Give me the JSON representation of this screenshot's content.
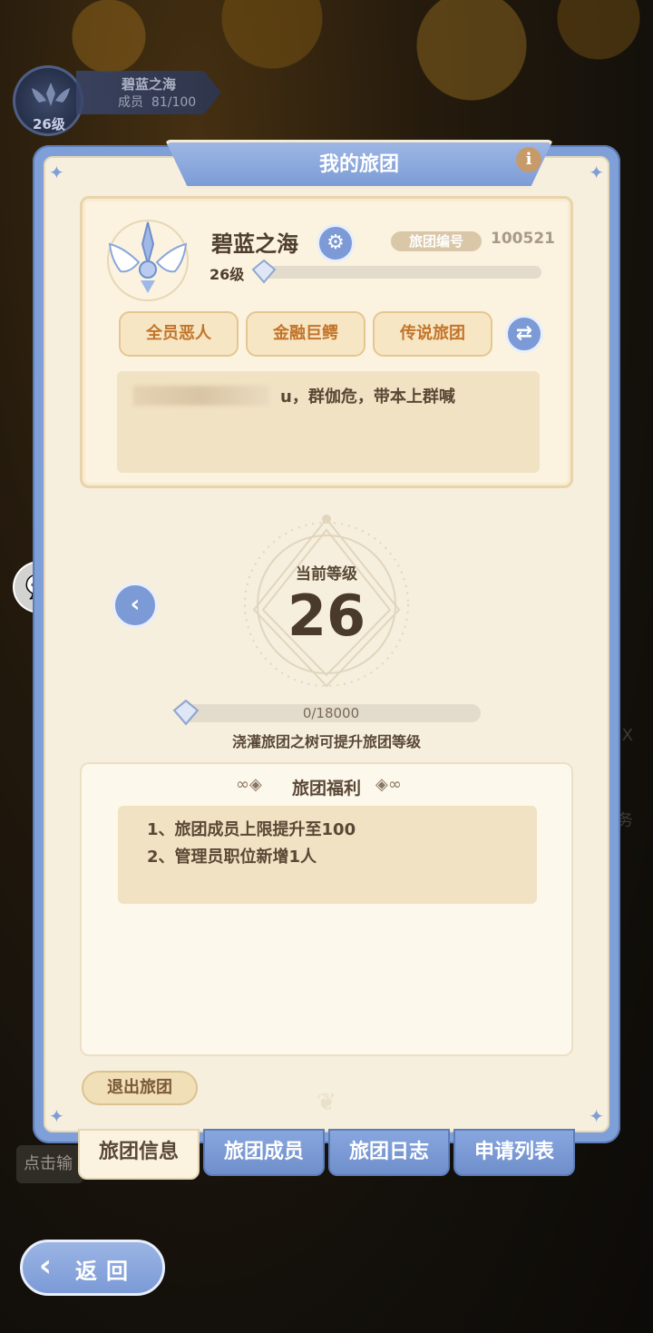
{
  "hud": {
    "guild_name": "碧蓝之海",
    "members_label": "成员",
    "members_value": "81/100",
    "level": "26级"
  },
  "panel": {
    "title": "我的旅团",
    "info_icon": "i"
  },
  "guild": {
    "name": "碧蓝之海",
    "id_label": "旅团编号",
    "id_value": "100521",
    "level": "26级",
    "tags": [
      "全员恶人",
      "金融巨鳄",
      "传说旅团"
    ],
    "notice": "u，群伽危，带本上群喊"
  },
  "level_display": {
    "label": "当前等级",
    "value": "26",
    "exp": "0/18000",
    "exp_fraction": 0,
    "hint": "浇灌旅团之树可提升旅团等级"
  },
  "benefits": {
    "title": "旅团福利",
    "items": [
      "1、旅团成员上限提升至100",
      "2、管理员职位新增1人"
    ]
  },
  "actions": {
    "quit": "退出旅团"
  },
  "tabs": [
    {
      "label": "旅团信息",
      "active": true
    },
    {
      "label": "旅团成员",
      "active": false
    },
    {
      "label": "旅团日志",
      "active": false
    },
    {
      "label": "申请列表",
      "active": false
    }
  ],
  "background": {
    "partial_text": "点击输",
    "side_texts": [
      "X",
      "务"
    ]
  },
  "back_button": "返回",
  "colors": {
    "panel_blue": "#7f9fd8",
    "parchment": "#f6efdd",
    "tag_text": "#c2742a",
    "text_dark": "#4e3d2c"
  }
}
